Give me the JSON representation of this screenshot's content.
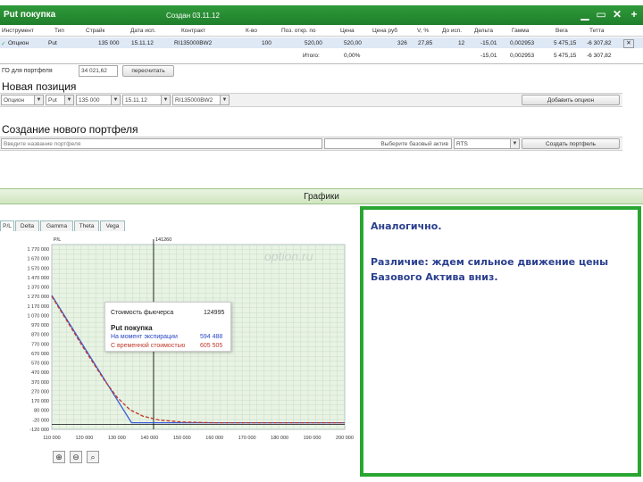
{
  "window": {
    "title": "Put покупка",
    "created": "Создан 03.11.12"
  },
  "positions": {
    "headers": [
      "Инструмент",
      "Тип",
      "Страйк",
      "Дата исп.",
      "Контракт",
      "К-во",
      "Поз. откр. по",
      "Цена",
      "Цена руб",
      "V, %",
      "До исп.",
      "Дельта",
      "Гамма",
      "Вега",
      "Тетта"
    ],
    "row": {
      "check": "✓",
      "instrument": "Опцион",
      "type": "Put",
      "strike": "135 000",
      "date": "15.11.12",
      "contract": "RI135000BW2",
      "qty": "100",
      "open_price": "520,00",
      "price": "520,00",
      "price_rub": "326",
      "vol": "27,85",
      "days": "12",
      "delta": "-15,01",
      "gamma": "0,002953",
      "vega": "5 475,15",
      "theta": "-6 307,82"
    },
    "total": {
      "label": "Итого:",
      "pct": "0,00%",
      "delta": "-15,01",
      "gamma": "0,002953",
      "vega": "5 475,15",
      "theta": "-6 307,82"
    }
  },
  "portfolio_line": {
    "label": "ГО для портфеля",
    "value": "34 021,62",
    "recalc_button": "пересчитать"
  },
  "new_position": {
    "title": "Новая позиция",
    "type_select": "Опцион",
    "put_select": "Put",
    "strike_select": "135 000",
    "date_select": "15.11.12",
    "contract_select": "RI135000BW2",
    "add_button": "Добавить опцион"
  },
  "new_portfolio": {
    "title": "Создание нового портфеля",
    "name_placeholder": "Введите название портфеля",
    "base_asset_label": "Выберите базовый актив",
    "base_asset_value": "RTS",
    "create_button": "Создать портфель"
  },
  "charts": {
    "title": "Графики",
    "tabs": [
      "P/L",
      "Delta",
      "Gamma",
      "Theta",
      "Vega"
    ],
    "active_tab": "P/L",
    "watermark": "option.ru",
    "current_price_label": "141260",
    "y_axis_label": "P/L",
    "tooltip": {
      "futures_label": "Стоимость фьючерса",
      "futures_value": "124995",
      "title": "Put покупка",
      "expiry_label": "На момент экспирации",
      "expiry_value": "594 488",
      "time_label": "С временной стоимостью",
      "time_value": "605 505"
    },
    "colors": {
      "expiry": "#3a5bd9",
      "time_value": "#c0392b",
      "bg": "#e8f3e4",
      "grid": "#c7dcc5"
    },
    "chart_data": {
      "type": "line",
      "x_ticks": [
        "110 000",
        "120 000",
        "130 000",
        "140 000",
        "150 000",
        "160 000",
        "170 000",
        "180 000",
        "190 000",
        "200 000"
      ],
      "y_ticks": [
        "1 770 000",
        "1 670 000",
        "1 570 000",
        "1 470 000",
        "1 370 000",
        "1 270 000",
        "1 170 000",
        "1 070 000",
        "970 000",
        "870 000",
        "770 000",
        "670 000",
        "570 000",
        "470 000",
        "370 000",
        "270 000",
        "170 000",
        "80 000",
        "-20 000",
        "-120 000"
      ],
      "xlim": [
        110000,
        200000
      ],
      "ylim": [
        -120000,
        1770000
      ],
      "current_price": 141260,
      "series": [
        {
          "name": "На момент экспирации",
          "points": [
            [
              110000,
              1250000
            ],
            [
              134500,
              -52000
            ],
            [
              200000,
              -52000
            ]
          ]
        },
        {
          "name": "С временной стоимостью",
          "points": [
            [
              110000,
              1240000
            ],
            [
              120000,
              700000
            ],
            [
              126000,
              390000
            ],
            [
              130000,
              210000
            ],
            [
              134000,
              80000
            ],
            [
              138000,
              15000
            ],
            [
              143000,
              -25000
            ],
            [
              150000,
              -45000
            ],
            [
              160000,
              -52000
            ],
            [
              200000,
              -52000
            ]
          ]
        }
      ]
    },
    "zoom_icons": [
      "zoom-in-icon",
      "zoom-out-icon",
      "zoom-reset-icon"
    ]
  },
  "note": {
    "line1": "Аналогично.",
    "line2": "Различие: ждем сильное движение цены Базового Актива вниз."
  }
}
